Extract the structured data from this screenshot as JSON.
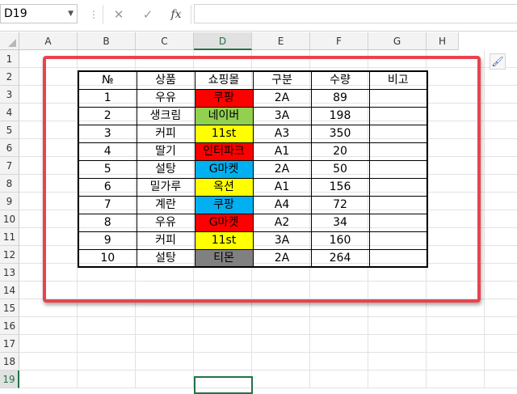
{
  "formula_bar": {
    "name_box": "D19",
    "cancel_icon": "✕",
    "enter_icon": "✓",
    "fx_label": "fx",
    "formula": ""
  },
  "columns": [
    "A",
    "B",
    "C",
    "D",
    "E",
    "F",
    "G",
    "H"
  ],
  "rows": [
    "1",
    "2",
    "3",
    "4",
    "5",
    "6",
    "7",
    "8",
    "9",
    "10",
    "11",
    "12",
    "13",
    "14",
    "15",
    "16",
    "17",
    "18",
    "19"
  ],
  "selected_cell": "D19",
  "table": {
    "headers": [
      "№",
      "상품",
      "쇼핑몰",
      "구분",
      "수량",
      "비고"
    ],
    "rows": [
      {
        "no": "1",
        "product": "우유",
        "mall": "쿠팡",
        "type": "2A",
        "qty": "89",
        "note": "",
        "mall_color": "#ff0000"
      },
      {
        "no": "2",
        "product": "생크림",
        "mall": "네이버",
        "type": "3A",
        "qty": "198",
        "note": "",
        "mall_color": "#92d050"
      },
      {
        "no": "3",
        "product": "커피",
        "mall": "11st",
        "type": "A3",
        "qty": "350",
        "note": "",
        "mall_color": "#ffff00"
      },
      {
        "no": "4",
        "product": "딸기",
        "mall": "인터파크",
        "type": "A1",
        "qty": "20",
        "note": "",
        "mall_color": "#ff0000"
      },
      {
        "no": "5",
        "product": "설탕",
        "mall": "G마켓",
        "type": "2A",
        "qty": "50",
        "note": "",
        "mall_color": "#00b0f0"
      },
      {
        "no": "6",
        "product": "밀가루",
        "mall": "옥션",
        "type": "A1",
        "qty": "156",
        "note": "",
        "mall_color": "#ffff00"
      },
      {
        "no": "7",
        "product": "계란",
        "mall": "쿠팡",
        "type": "A4",
        "qty": "72",
        "note": "",
        "mall_color": "#00b0f0"
      },
      {
        "no": "8",
        "product": "우유",
        "mall": "G마켓",
        "type": "A2",
        "qty": "34",
        "note": "",
        "mall_color": "#ff0000"
      },
      {
        "no": "9",
        "product": "커피",
        "mall": "11st",
        "type": "3A",
        "qty": "160",
        "note": "",
        "mall_color": "#ffff00"
      },
      {
        "no": "10",
        "product": "설탕",
        "mall": "티몬",
        "type": "2A",
        "qty": "264",
        "note": "",
        "mall_color": "#808080"
      }
    ]
  },
  "colors": {
    "excel_green": "#217346",
    "highlight_box": "#e8444d"
  },
  "icons": {
    "quick_analysis": "format-painter-icon"
  }
}
